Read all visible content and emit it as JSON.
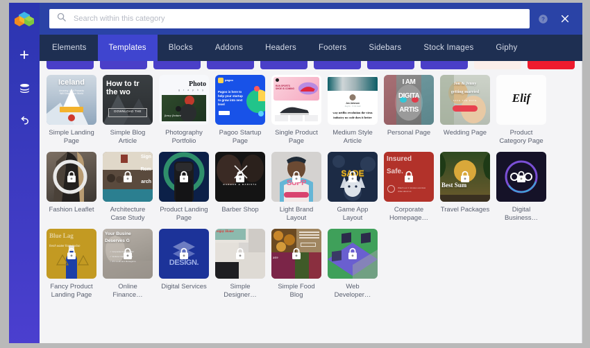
{
  "app": {
    "rail": {
      "logo_icon": "cube-logo-icon",
      "buttons": [
        {
          "name": "add-element-button",
          "icon": "plus-icon"
        },
        {
          "name": "layers-button",
          "icon": "layers-icon"
        },
        {
          "name": "undo-button",
          "icon": "undo-icon"
        }
      ]
    },
    "header": {
      "search": {
        "icon": "search-icon",
        "placeholder": "Search within this category",
        "value": ""
      },
      "help_icon": "question-circle-icon",
      "close_icon": "close-icon"
    },
    "tabs": [
      {
        "label": "Elements",
        "active": false
      },
      {
        "label": "Templates",
        "active": true
      },
      {
        "label": "Blocks",
        "active": false
      },
      {
        "label": "Addons",
        "active": false
      },
      {
        "label": "Headers",
        "active": false
      },
      {
        "label": "Footers",
        "active": false
      },
      {
        "label": "Sidebars",
        "active": false
      },
      {
        "label": "Stock Images",
        "active": false
      },
      {
        "label": "Giphy",
        "active": false
      }
    ],
    "colors": {
      "rail": "#3a3ec4",
      "header": "#2a43a6",
      "tabbar": "#1e2f52",
      "tab_active": "#3f45cf",
      "content_bg": "#f4f4f6",
      "caption": "#5a6070"
    },
    "partial_row_above": [
      {
        "color": "#4a3fc8",
        "span": 8
      },
      {
        "color": "#fbeeea",
        "span": 1
      },
      {
        "color": "#ee1b2e",
        "span": 1
      }
    ],
    "templates": [
      {
        "title": "Simple Landing Page",
        "locked": false,
        "style": "iceland"
      },
      {
        "title": "Simple Blog Article",
        "locked": false,
        "style": "blog"
      },
      {
        "title": "Photography Portfolio",
        "locked": false,
        "style": "photo"
      },
      {
        "title": "Pagoo Startup Page",
        "locked": false,
        "style": "pagoo"
      },
      {
        "title": "Single Product Page",
        "locked": false,
        "style": "product"
      },
      {
        "title": "Medium Style Article",
        "locked": false,
        "style": "medium"
      },
      {
        "title": "Personal Page",
        "locked": false,
        "style": "digital-artist"
      },
      {
        "title": "Wedding Page",
        "locked": false,
        "style": "wedding"
      },
      {
        "title": "Product Category Page",
        "locked": false,
        "style": "elif"
      },
      {
        "title": "Fashion Leaflet",
        "locked": true,
        "style": "fashion"
      },
      {
        "title": "Architecture Case Study",
        "locked": true,
        "style": "architecture"
      },
      {
        "title": "Product Landing Page",
        "locked": true,
        "style": "speaker"
      },
      {
        "title": "Barber Shop",
        "locked": true,
        "style": "barber"
      },
      {
        "title": "Light Brand Layout",
        "locked": true,
        "style": "supp"
      },
      {
        "title": "Game App Layout",
        "locked": true,
        "style": "sade"
      },
      {
        "title": "Corporate Homepage…",
        "locked": true,
        "style": "insured"
      },
      {
        "title": "Travel Packages",
        "locked": true,
        "style": "travel"
      },
      {
        "title": "Digital Business…",
        "locked": true,
        "style": "digital-biz"
      },
      {
        "title": "Fancy Product Landing Page",
        "locked": true,
        "style": "bluelagoon"
      },
      {
        "title": "Online Finance…",
        "locked": true,
        "style": "finance"
      },
      {
        "title": "Digital Services",
        "locked": true,
        "style": "design"
      },
      {
        "title": "Simple Designer…",
        "locked": true,
        "style": "designer"
      },
      {
        "title": "Simple Food Blog",
        "locked": true,
        "style": "food"
      },
      {
        "title": "Web Developer…",
        "locked": true,
        "style": "webdev"
      }
    ]
  }
}
